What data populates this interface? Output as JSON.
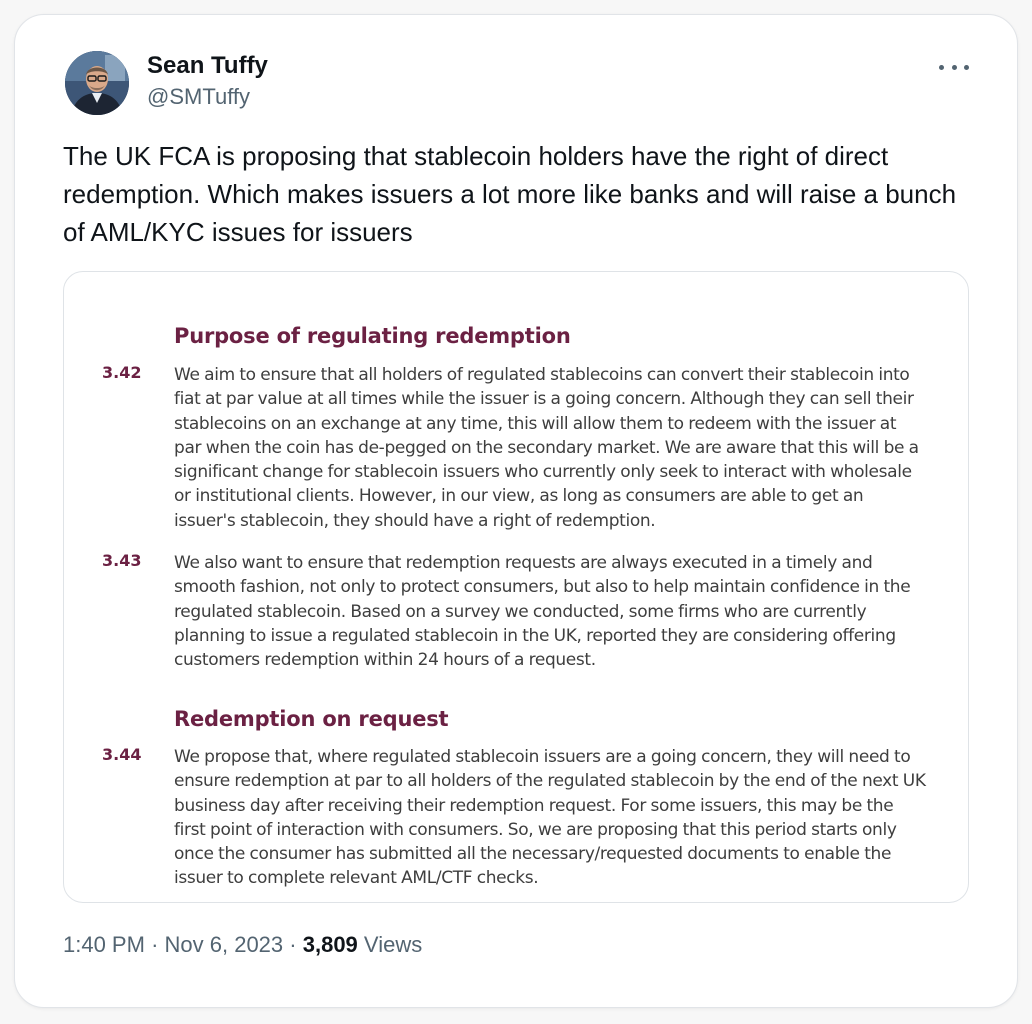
{
  "tweet": {
    "author": {
      "display_name": "Sean Tuffy",
      "handle": "@SMTuffy"
    },
    "text": "The UK FCA is proposing that stablecoin holders have the right of direct redemption. Which makes issuers a lot more like banks and will raise a bunch of AML/KYC issues for issuers",
    "more_icon": "more-horizontal-icon",
    "media": {
      "heading1": "Purpose of regulating redemption",
      "heading2": "Redemption on request",
      "paragraphs": [
        {
          "number": "3.42",
          "text": "We aim to ensure that all holders of regulated stablecoins can convert their stablecoin into fiat at par value at all times while the issuer is a going concern. Although they can sell their stablecoins on an exchange at any time, this will allow them to redeem with the issuer at par when the coin has de-pegged on the secondary market. We are aware that this will be a significant change for stablecoin issuers who currently only seek to interact with wholesale or institutional clients. However, in our view, as long as consumers are able to get an issuer's stablecoin, they should have a right of redemption."
        },
        {
          "number": "3.43",
          "text": "We also want to ensure that redemption requests are always executed in a timely and smooth fashion, not only to protect consumers, but also to help maintain confidence in the regulated stablecoin. Based on a survey we conducted, some firms who are currently planning to issue a regulated stablecoin in the UK, reported they are considering offering customers redemption within 24 hours of a request."
        },
        {
          "number": "3.44",
          "text": "We propose that, where regulated stablecoin issuers are a going concern, they will need to ensure redemption at par to all holders of the regulated stablecoin by the end of the next UK business day after receiving their redemption request. For some issuers, this may be the first point of interaction with consumers. So, we are proposing that this period starts only once the consumer has submitted all the necessary/requested documents to enable the issuer to complete relevant AML/CTF checks."
        }
      ]
    },
    "meta": {
      "time": "1:40 PM",
      "separator": "·",
      "date": "Nov 6, 2023",
      "views_count": "3,809",
      "views_label": "Views"
    }
  },
  "colors": {
    "text_primary": "#0f1419",
    "text_secondary": "#536471",
    "doc_accent": "#6b2143"
  }
}
